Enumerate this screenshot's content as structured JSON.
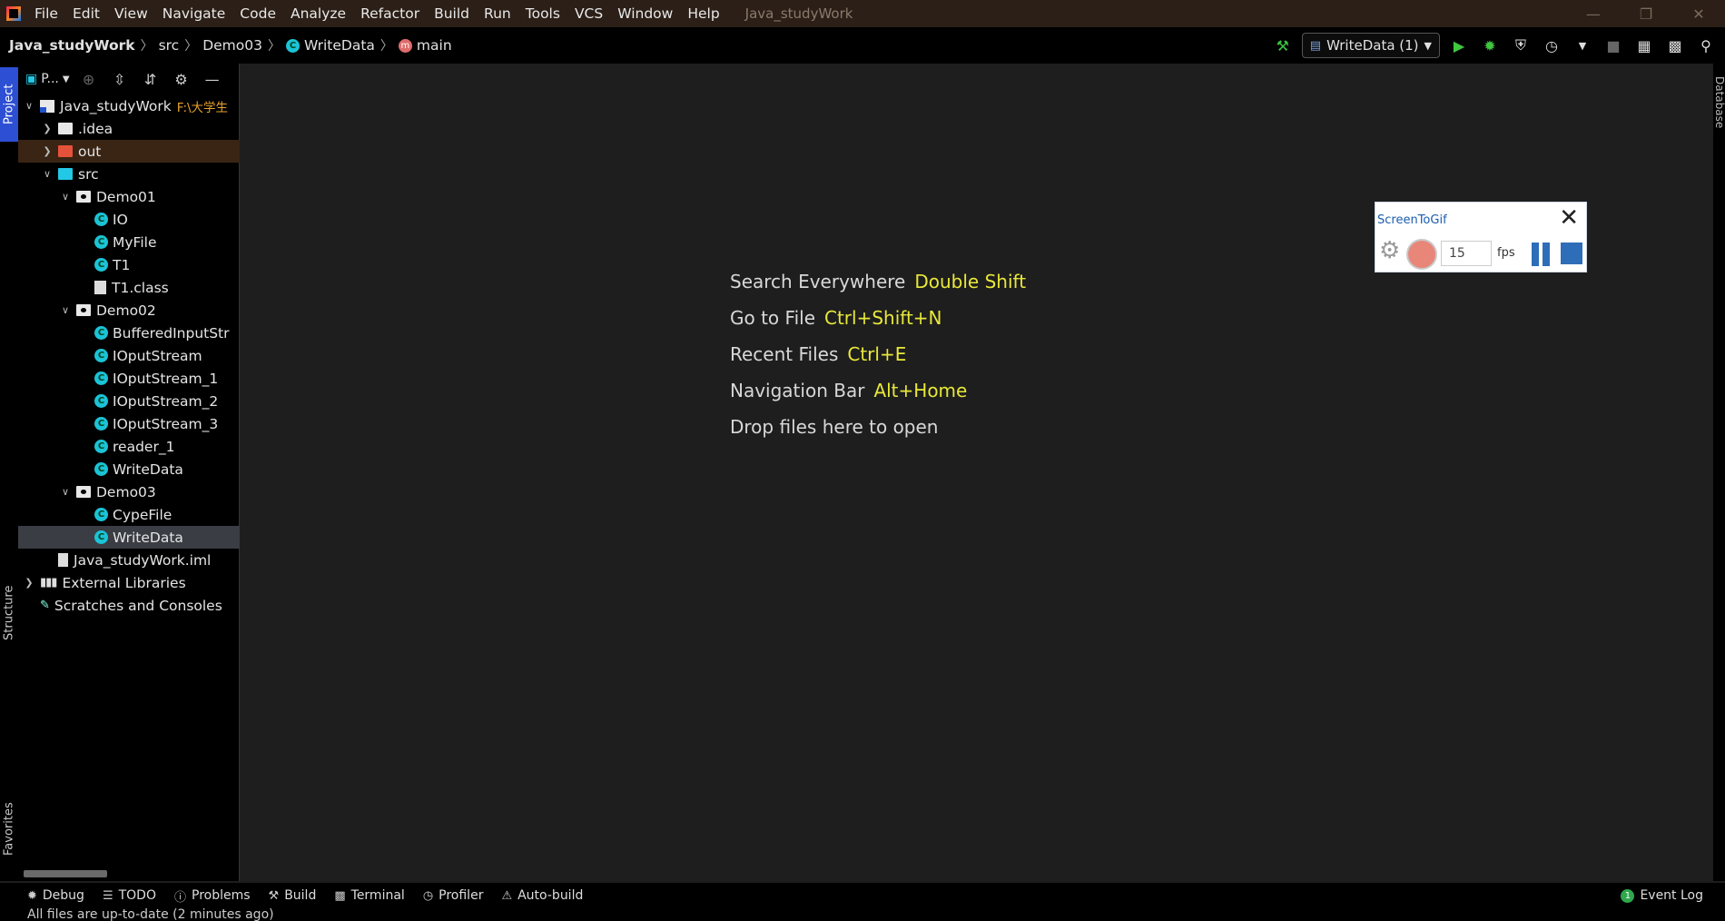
{
  "menubar": {
    "items": [
      "File",
      "Edit",
      "View",
      "Navigate",
      "Code",
      "Analyze",
      "Refactor",
      "Build",
      "Run",
      "Tools",
      "VCS",
      "Window",
      "Help"
    ],
    "window_title": "Java_studyWork"
  },
  "navbar": {
    "crumbs": [
      "Java_studyWork",
      "src",
      "Demo03",
      "WriteData",
      "main"
    ]
  },
  "run_config": "WriteData (1)",
  "project_panel": {
    "selector": "P..."
  },
  "tree": [
    {
      "label": "Java_studyWork",
      "path": "F:\\大学生",
      "level": 0,
      "icon": "project-root-icon",
      "expanded": true
    },
    {
      "label": ".idea",
      "level": 1,
      "icon": "folder-icon",
      "expanded": false
    },
    {
      "label": "out",
      "level": 1,
      "icon": "excluded-folder-icon",
      "expanded": false
    },
    {
      "label": "src",
      "level": 1,
      "icon": "source-folder-icon",
      "expanded": true
    },
    {
      "label": "Demo01",
      "level": 2,
      "icon": "package-icon",
      "expanded": true
    },
    {
      "label": "IO",
      "level": 3,
      "icon": "class-icon"
    },
    {
      "label": "MyFile",
      "level": 3,
      "icon": "class-icon"
    },
    {
      "label": "T1",
      "level": 3,
      "icon": "class-icon"
    },
    {
      "label": "T1.class",
      "level": 3,
      "icon": "class-file-icon"
    },
    {
      "label": "Demo02",
      "level": 2,
      "icon": "package-icon",
      "expanded": true
    },
    {
      "label": "BufferedInputStr",
      "level": 3,
      "icon": "class-icon"
    },
    {
      "label": "IOputStream",
      "level": 3,
      "icon": "class-icon"
    },
    {
      "label": "IOputStream_1",
      "level": 3,
      "icon": "class-icon"
    },
    {
      "label": "IOputStream_2",
      "level": 3,
      "icon": "class-icon"
    },
    {
      "label": "IOputStream_3",
      "level": 3,
      "icon": "class-icon"
    },
    {
      "label": "reader_1",
      "level": 3,
      "icon": "class-icon"
    },
    {
      "label": "WriteData",
      "level": 3,
      "icon": "class-icon"
    },
    {
      "label": "Demo03",
      "level": 2,
      "icon": "package-icon",
      "expanded": true
    },
    {
      "label": "CypeFile",
      "level": 3,
      "icon": "class-icon"
    },
    {
      "label": "WriteData",
      "level": 3,
      "icon": "class-icon",
      "selected": true
    },
    {
      "label": "Java_studyWork.iml",
      "level": 1,
      "icon": "iml-file-icon"
    },
    {
      "label": "External Libraries",
      "level": 0,
      "icon": "library-icon",
      "expanded": false
    },
    {
      "label": "Scratches and Consoles",
      "level": 0,
      "icon": "scratches-icon"
    }
  ],
  "left_tabs": {
    "project": "Project",
    "structure": "Structure",
    "favorites": "Favorites"
  },
  "right_tabs": {
    "database": "Database"
  },
  "welcome": [
    {
      "text": "Search Everywhere",
      "key": "Double Shift"
    },
    {
      "text": "Go to File",
      "key": "Ctrl+Shift+N"
    },
    {
      "text": "Recent Files",
      "key": "Ctrl+E"
    },
    {
      "text": "Navigation Bar",
      "key": "Alt+Home"
    },
    {
      "text": "Drop files here to open",
      "key": ""
    }
  ],
  "screentogif": {
    "title": "ScreenToGif",
    "fps_value": "15",
    "fps_label": "fps"
  },
  "tool_windows": [
    {
      "label": "Debug",
      "icon": "debug-icon"
    },
    {
      "label": "TODO",
      "icon": "todo-icon"
    },
    {
      "label": "Problems",
      "icon": "problems-icon"
    },
    {
      "label": "Build",
      "icon": "build-icon"
    },
    {
      "label": "Terminal",
      "icon": "terminal-icon"
    },
    {
      "label": "Profiler",
      "icon": "profiler-icon"
    },
    {
      "label": "Auto-build",
      "icon": "warning-icon"
    }
  ],
  "event_log": {
    "label": "Event Log",
    "count": "1"
  },
  "status": "All files are up-to-date (2 minutes ago)",
  "colors": {
    "accent": "#2d4fd3",
    "key_hint": "#e8e83a",
    "class_icon": "#1bc3d6"
  }
}
